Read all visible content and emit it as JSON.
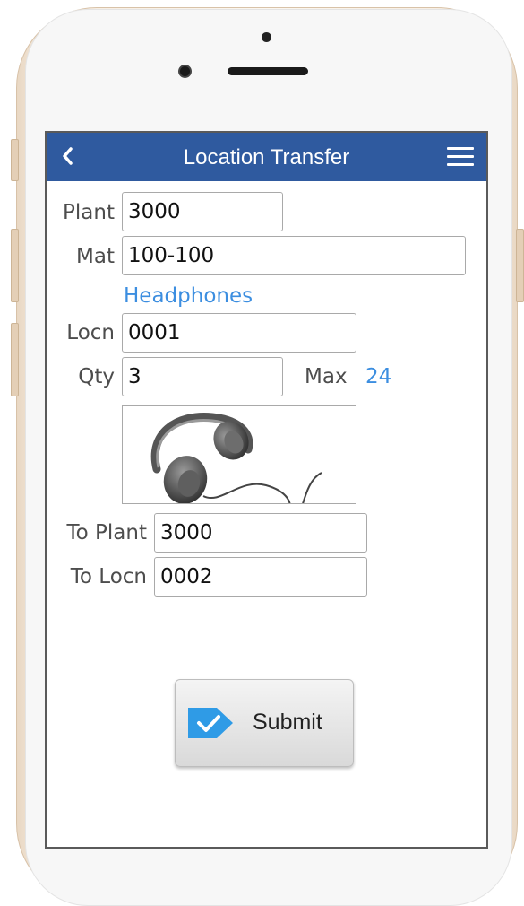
{
  "header": {
    "title": "Location Transfer"
  },
  "form": {
    "plant_label": "Plant",
    "plant_value": "3000",
    "mat_label": "Mat",
    "mat_value": "100-100",
    "material_description": "Headphones",
    "locn_label": "Locn",
    "locn_value": "0001",
    "qty_label": "Qty",
    "qty_value": "3",
    "max_label": "Max",
    "max_value": "24",
    "to_plant_label": "To Plant",
    "to_plant_value": "3000",
    "to_locn_label": "To Locn",
    "to_locn_value": "0002"
  },
  "submit": {
    "label": "Submit"
  },
  "icons": {
    "back": "chevron-left-icon",
    "menu": "hamburger-menu-icon",
    "submit": "checkmark-tag-icon",
    "product": "headphones-image"
  },
  "colors": {
    "title_bar": "#2f5a9f",
    "accent_blue": "#3c8ee0",
    "submit_icon": "#2f9be6"
  }
}
